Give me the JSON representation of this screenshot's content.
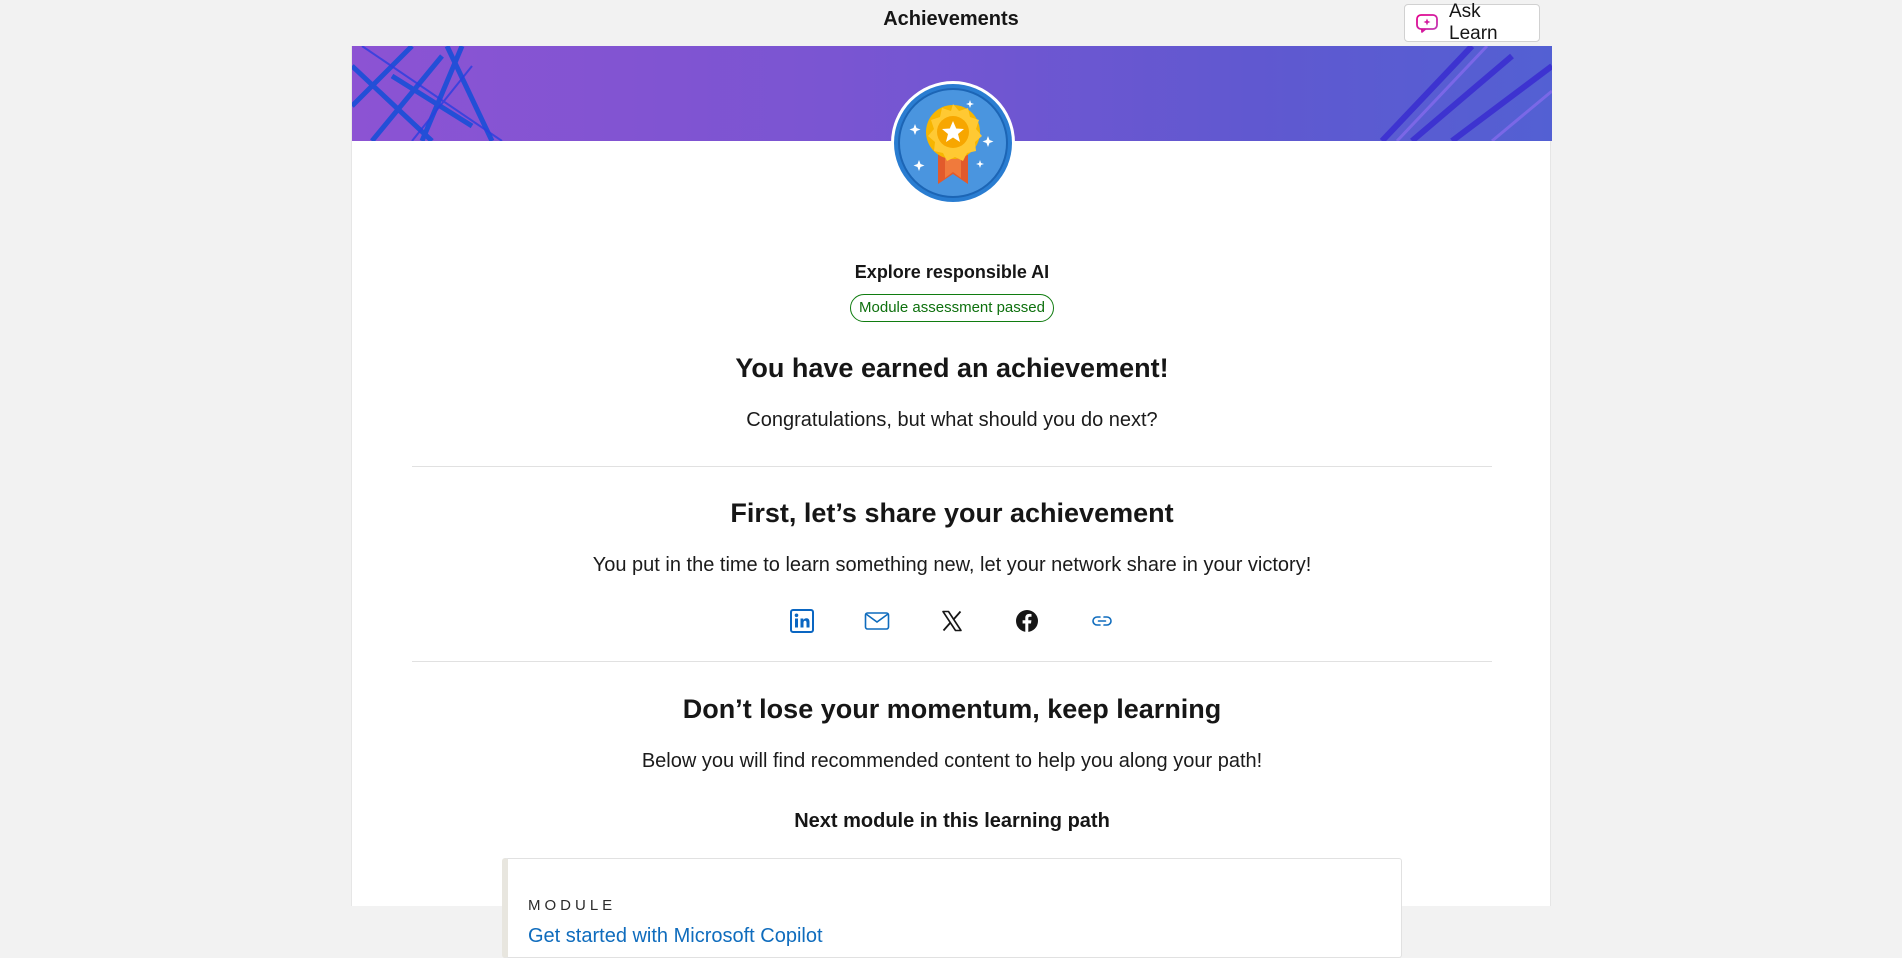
{
  "header": {
    "title": "Achievements",
    "ask_learn_label": "Ask Learn"
  },
  "achievement": {
    "module_name": "Explore responsible AI",
    "status": "Module assessment passed",
    "heading": "You have earned an achievement!",
    "subtext": "Congratulations, but what should you do next?"
  },
  "share": {
    "heading": "First, let’s share your achievement",
    "subtext": "You put in the time to learn something new, let your network share in your victory!",
    "buttons": [
      {
        "icon": "linkedin-icon"
      },
      {
        "icon": "email-icon"
      },
      {
        "icon": "x-icon"
      },
      {
        "icon": "facebook-icon"
      },
      {
        "icon": "link-icon"
      }
    ]
  },
  "next": {
    "heading": "Don’t lose your momentum, keep learning",
    "subtext": "Below you will find recommended content to help you along your path!",
    "section_label": "Next module in this learning path",
    "module_type": "MODULE",
    "module_title": "Get started with Microsoft Copilot"
  },
  "colors": {
    "accent": "#0f6cbd",
    "success": "#107c10",
    "banner_start": "#8c53d3",
    "banner_end": "#5360d3"
  }
}
